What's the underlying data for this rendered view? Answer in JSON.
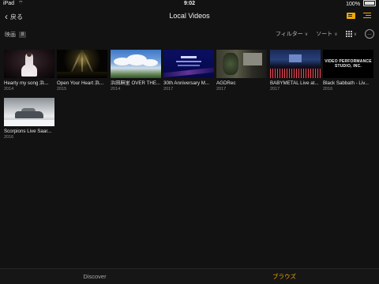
{
  "status_bar": {
    "device": "iPad",
    "time": "9:02",
    "battery": "100%"
  },
  "nav": {
    "back_label": "戻る",
    "title": "Local Videos"
  },
  "toolbar": {
    "section_label": "映画",
    "count": "8",
    "filter_label": "フィルター",
    "sort_label": "ソート",
    "more_label": "…"
  },
  "videos": [
    {
      "title": "Hearty my song 浜...",
      "year": "2014"
    },
    {
      "title": "Open Your Heart 浜...",
      "year": "2015"
    },
    {
      "title": "浜田麻里 OVER THE...",
      "year": "2014"
    },
    {
      "title": "30th Anniversary M...",
      "year": "2017"
    },
    {
      "title": "AGDRec",
      "year": "2017"
    },
    {
      "title": "BABYMETAL Live at...",
      "year": "2017"
    },
    {
      "title": "Black Sabbath - Liv...",
      "year": "2016",
      "thumb_text": "VIDEO PERFORMANCE STUDIO, INC."
    },
    {
      "title": "Scorpions Live Saar...",
      "year": "2016"
    }
  ],
  "tabs": {
    "discover": "Discover",
    "browse": "ブラウズ"
  },
  "colors": {
    "accent": "#f2a700",
    "background": "#121212"
  }
}
